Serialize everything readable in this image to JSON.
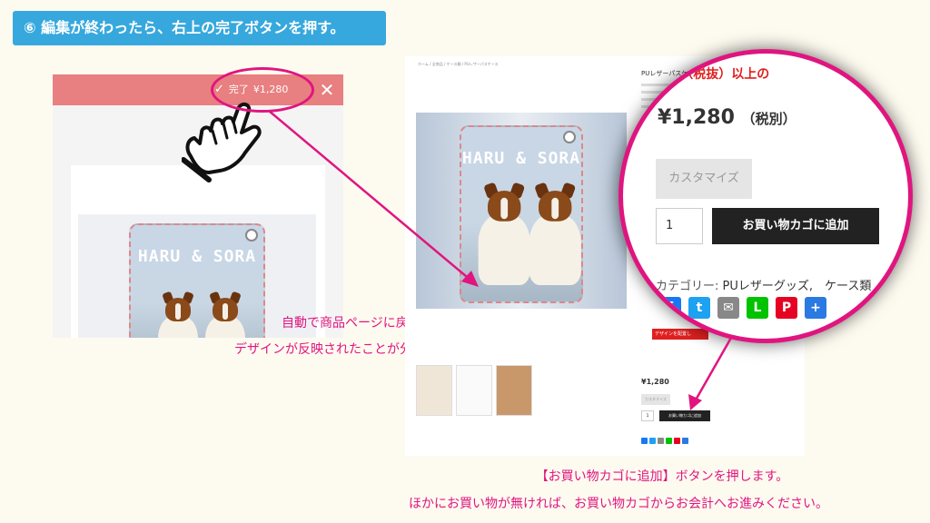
{
  "step_banner": "⑥ 編集が終わったら、右上の完了ボタンを押す。",
  "editor": {
    "done_label": "完了",
    "done_price": "¥1,280",
    "case_text": "HARU & SORA",
    "close_symbol": "✕"
  },
  "caption1": {
    "line1": "自動で商品ページに戻り、",
    "line2": "デザインが反映されたことが分かります。"
  },
  "product": {
    "title_small": "PUレザーパスケース",
    "price_small": "¥1,280",
    "customize_small": "カスタマイズ",
    "qty_small": "1",
    "cart_small": "お買い物カゴに追加",
    "design_btn": "デザインを配置し"
  },
  "magnifier": {
    "title": "000円（税抜）以上の",
    "price": "¥1,280",
    "tax": "（税別）",
    "customize": "カスタマイズ",
    "qty": "1",
    "cart": "お買い物カゴに追加",
    "category_label": "カテゴリー:",
    "category_links": "PUレザーグッズ,　ケース類"
  },
  "caption2": {
    "line1": "【お買い物カゴに追加】ボタンを押します。",
    "line2": "ほかにお買い物が無ければ、お買い物カゴからお会計へお進みください。"
  },
  "colors": {
    "banner": "#37a8dd",
    "accent": "#e0157f",
    "editor_bar": "#e87f80"
  }
}
